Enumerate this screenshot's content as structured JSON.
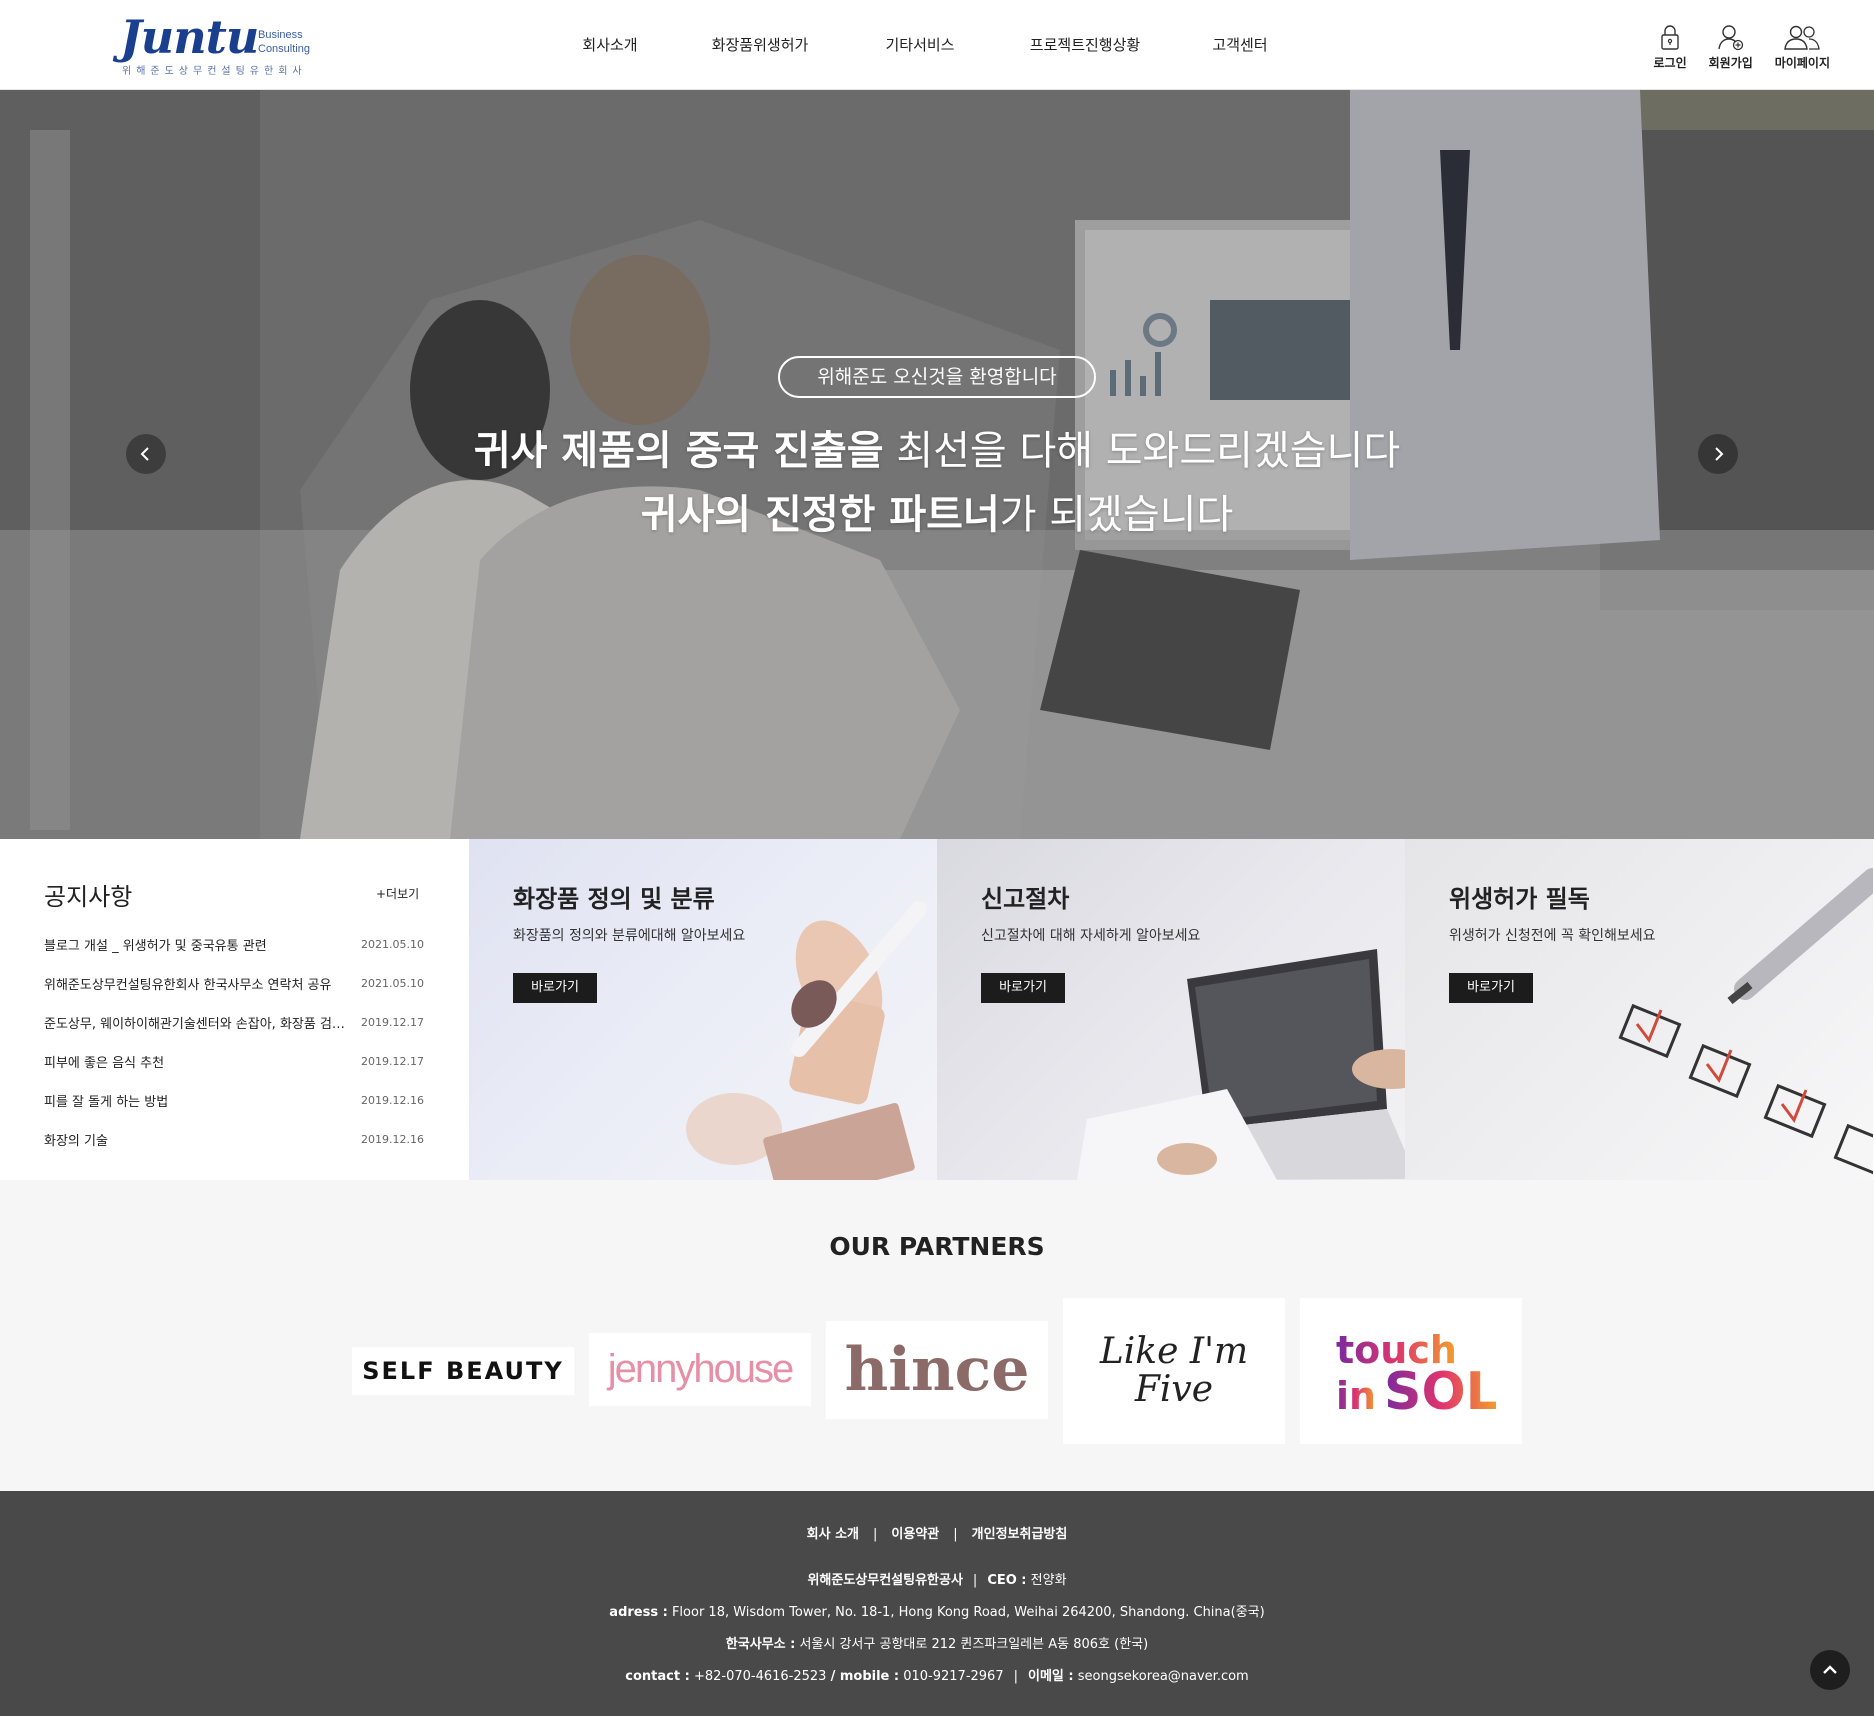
{
  "header": {
    "logo": {
      "word": "Juntu",
      "side_line1": "Business",
      "side_line2": "Consulting",
      "subtitle": "위해준도상무컨설팅유한회사"
    },
    "nav": [
      "회사소개",
      "화장품위생허가",
      "기타서비스",
      "프로젝트진행상황",
      "고객센터"
    ],
    "util": [
      {
        "label": "로그인",
        "icon": "lock-icon"
      },
      {
        "label": "회원가입",
        "icon": "user-add-icon"
      },
      {
        "label": "마이페이지",
        "icon": "users-icon"
      }
    ]
  },
  "hero": {
    "badge": "위해준도 오신것을 환영합니다",
    "line1_bold": "귀사 제품의 중국 진출을",
    "line1_light": " 최선을 다해 도와드리겠습니다",
    "line2_bold": "귀사의 진정한 파트너",
    "line2_light": "가 되겠습니다"
  },
  "notice": {
    "title": "공지사항",
    "more": "+더보기",
    "items": [
      {
        "title": "블로그 개설 _ 위생허가 및 중국유통 관련",
        "date": "2021.05.10"
      },
      {
        "title": "위해준도상무컨설팅유한회사 한국사무소 연락처 공유",
        "date": "2021.05.10"
      },
      {
        "title": "준도상무, 웨이하이해관기술센터와 손잡아, 화장품 검사 협력",
        "date": "2019.12.17"
      },
      {
        "title": "피부에 좋은 음식 추천",
        "date": "2019.12.17"
      },
      {
        "title": "피를 잘 돌게 하는 방법",
        "date": "2019.12.16"
      },
      {
        "title": "화장의 기술",
        "date": "2019.12.16"
      }
    ]
  },
  "cards": [
    {
      "title": "화장품 정의 및 분류",
      "desc": "화장품의 정의와 분류에대해 알아보세요",
      "button": "바로가기"
    },
    {
      "title": "신고절차",
      "desc": "신고절차에 대해 자세하게 알아보세요",
      "button": "바로가기"
    },
    {
      "title": "위생허가 필독",
      "desc": "위생허가 신청전에 꼭 확인해보세요",
      "button": "바로가기"
    }
  ],
  "partners": {
    "title": "OUR PARTNERS",
    "logos": [
      "SELF BEAUTY",
      "jennyhouse",
      "hince",
      "Like I'm Five",
      "touch in SOL"
    ]
  },
  "footer": {
    "nav": [
      "회사 소개",
      "이용약관",
      "개인정보취급방침"
    ],
    "company_label": "위해준도상무컨설팅유한공사",
    "ceo_label": "CEO :",
    "ceo_name": "전양화",
    "address_label": "adress :",
    "address": "Floor 18, Wisdom Tower, No. 18-1, Hong Kong Road, Weihai 264200, Shandong. China(중국)",
    "kr_office_label": "한국사무소 :",
    "kr_office": "서울시 강서구 공항대로 212 퀸즈파크일레븐 A동 806호 (한국)",
    "contact_label": "contact :",
    "contact": "+82-070-4616-2523",
    "mobile_label": "/ mobile :",
    "mobile": "010-9217-2967",
    "email_label": "이메일 :",
    "email": "seongsekorea@naver.com"
  },
  "colors": {
    "brand": "#1b3f8f",
    "footer_bg": "#494949",
    "partners_bg": "#f6f6f6",
    "button_bg": "#1c1c1c"
  }
}
